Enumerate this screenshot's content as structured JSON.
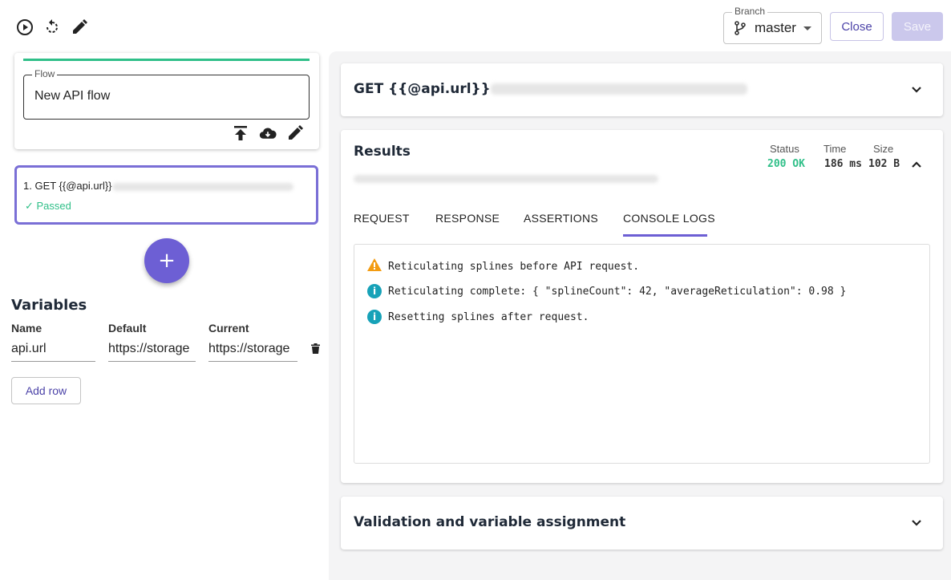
{
  "toolbar": {
    "branch_label": "Branch",
    "branch_value": "master",
    "close_label": "Close",
    "save_label": "Save"
  },
  "flow": {
    "field_label": "Flow",
    "field_value": "New API flow"
  },
  "steps": [
    {
      "title": "1. GET {{@api.url}}",
      "status": "✓ Passed"
    }
  ],
  "variables": {
    "title": "Variables",
    "headers": [
      "Name",
      "Default",
      "Current"
    ],
    "rows": [
      {
        "name": "api.url",
        "default": "https://storage",
        "current": "https://storage"
      }
    ],
    "add_row_label": "Add row"
  },
  "request_panel": {
    "title": "GET {{@api.url}}"
  },
  "results": {
    "title": "Results",
    "status_label": "Status",
    "status_value": "200 OK",
    "time_label": "Time",
    "time_value": "186 ms",
    "size_label": "Size",
    "size_value": "102 B",
    "tabs": [
      "REQUEST",
      "RESPONSE",
      "ASSERTIONS",
      "CONSOLE LOGS"
    ],
    "active_tab": "CONSOLE LOGS",
    "logs": [
      {
        "level": "warning",
        "text": "Reticulating splines before API request."
      },
      {
        "level": "info",
        "text": "Reticulating complete: { \"splineCount\": 42, \"averageReticulation\": 0.98 }"
      },
      {
        "level": "info",
        "text": "Resetting splines after request."
      }
    ]
  },
  "validation_panel": {
    "title": "Validation and variable assignment"
  },
  "colors": {
    "accent": "#6d5fd4",
    "success": "#2fbf88",
    "warning": "#f39c12",
    "info": "#17a2b8"
  }
}
